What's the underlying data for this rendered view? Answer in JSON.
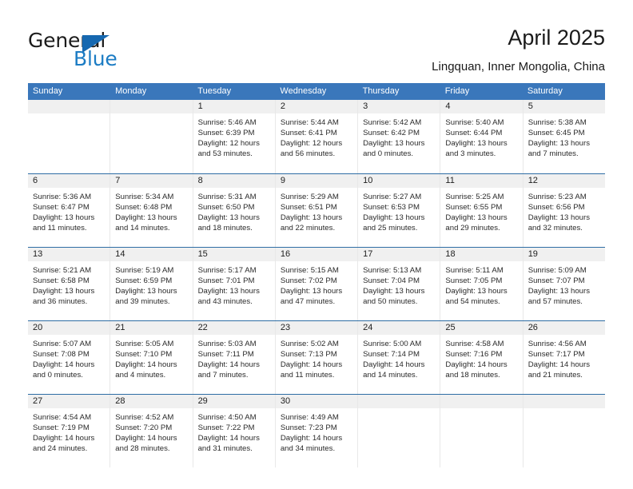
{
  "brand": {
    "name_part1": "General",
    "name_part2": "Blue",
    "logo_icon": "triangle-flag-icon"
  },
  "header": {
    "title": "April 2025",
    "location": "Lingquan, Inner Mongolia, China"
  },
  "calendar": {
    "day_headers": [
      "Sunday",
      "Monday",
      "Tuesday",
      "Wednesday",
      "Thursday",
      "Friday",
      "Saturday"
    ],
    "accent_color": "#3a77bb",
    "row_divider_color": "#2e6da4",
    "day_band_color": "#f0f0f0",
    "weeks": [
      [
        {
          "date": "",
          "empty": true
        },
        {
          "date": "",
          "empty": true
        },
        {
          "date": "1",
          "sunrise": "Sunrise: 5:46 AM",
          "sunset": "Sunset: 6:39 PM",
          "daylight_line1": "Daylight: 12 hours",
          "daylight_line2": "and 53 minutes."
        },
        {
          "date": "2",
          "sunrise": "Sunrise: 5:44 AM",
          "sunset": "Sunset: 6:41 PM",
          "daylight_line1": "Daylight: 12 hours",
          "daylight_line2": "and 56 minutes."
        },
        {
          "date": "3",
          "sunrise": "Sunrise: 5:42 AM",
          "sunset": "Sunset: 6:42 PM",
          "daylight_line1": "Daylight: 13 hours",
          "daylight_line2": "and 0 minutes."
        },
        {
          "date": "4",
          "sunrise": "Sunrise: 5:40 AM",
          "sunset": "Sunset: 6:44 PM",
          "daylight_line1": "Daylight: 13 hours",
          "daylight_line2": "and 3 minutes."
        },
        {
          "date": "5",
          "sunrise": "Sunrise: 5:38 AM",
          "sunset": "Sunset: 6:45 PM",
          "daylight_line1": "Daylight: 13 hours",
          "daylight_line2": "and 7 minutes."
        }
      ],
      [
        {
          "date": "6",
          "sunrise": "Sunrise: 5:36 AM",
          "sunset": "Sunset: 6:47 PM",
          "daylight_line1": "Daylight: 13 hours",
          "daylight_line2": "and 11 minutes."
        },
        {
          "date": "7",
          "sunrise": "Sunrise: 5:34 AM",
          "sunset": "Sunset: 6:48 PM",
          "daylight_line1": "Daylight: 13 hours",
          "daylight_line2": "and 14 minutes."
        },
        {
          "date": "8",
          "sunrise": "Sunrise: 5:31 AM",
          "sunset": "Sunset: 6:50 PM",
          "daylight_line1": "Daylight: 13 hours",
          "daylight_line2": "and 18 minutes."
        },
        {
          "date": "9",
          "sunrise": "Sunrise: 5:29 AM",
          "sunset": "Sunset: 6:51 PM",
          "daylight_line1": "Daylight: 13 hours",
          "daylight_line2": "and 22 minutes."
        },
        {
          "date": "10",
          "sunrise": "Sunrise: 5:27 AM",
          "sunset": "Sunset: 6:53 PM",
          "daylight_line1": "Daylight: 13 hours",
          "daylight_line2": "and 25 minutes."
        },
        {
          "date": "11",
          "sunrise": "Sunrise: 5:25 AM",
          "sunset": "Sunset: 6:55 PM",
          "daylight_line1": "Daylight: 13 hours",
          "daylight_line2": "and 29 minutes."
        },
        {
          "date": "12",
          "sunrise": "Sunrise: 5:23 AM",
          "sunset": "Sunset: 6:56 PM",
          "daylight_line1": "Daylight: 13 hours",
          "daylight_line2": "and 32 minutes."
        }
      ],
      [
        {
          "date": "13",
          "sunrise": "Sunrise: 5:21 AM",
          "sunset": "Sunset: 6:58 PM",
          "daylight_line1": "Daylight: 13 hours",
          "daylight_line2": "and 36 minutes."
        },
        {
          "date": "14",
          "sunrise": "Sunrise: 5:19 AM",
          "sunset": "Sunset: 6:59 PM",
          "daylight_line1": "Daylight: 13 hours",
          "daylight_line2": "and 39 minutes."
        },
        {
          "date": "15",
          "sunrise": "Sunrise: 5:17 AM",
          "sunset": "Sunset: 7:01 PM",
          "daylight_line1": "Daylight: 13 hours",
          "daylight_line2": "and 43 minutes."
        },
        {
          "date": "16",
          "sunrise": "Sunrise: 5:15 AM",
          "sunset": "Sunset: 7:02 PM",
          "daylight_line1": "Daylight: 13 hours",
          "daylight_line2": "and 47 minutes."
        },
        {
          "date": "17",
          "sunrise": "Sunrise: 5:13 AM",
          "sunset": "Sunset: 7:04 PM",
          "daylight_line1": "Daylight: 13 hours",
          "daylight_line2": "and 50 minutes."
        },
        {
          "date": "18",
          "sunrise": "Sunrise: 5:11 AM",
          "sunset": "Sunset: 7:05 PM",
          "daylight_line1": "Daylight: 13 hours",
          "daylight_line2": "and 54 minutes."
        },
        {
          "date": "19",
          "sunrise": "Sunrise: 5:09 AM",
          "sunset": "Sunset: 7:07 PM",
          "daylight_line1": "Daylight: 13 hours",
          "daylight_line2": "and 57 minutes."
        }
      ],
      [
        {
          "date": "20",
          "sunrise": "Sunrise: 5:07 AM",
          "sunset": "Sunset: 7:08 PM",
          "daylight_line1": "Daylight: 14 hours",
          "daylight_line2": "and 0 minutes."
        },
        {
          "date": "21",
          "sunrise": "Sunrise: 5:05 AM",
          "sunset": "Sunset: 7:10 PM",
          "daylight_line1": "Daylight: 14 hours",
          "daylight_line2": "and 4 minutes."
        },
        {
          "date": "22",
          "sunrise": "Sunrise: 5:03 AM",
          "sunset": "Sunset: 7:11 PM",
          "daylight_line1": "Daylight: 14 hours",
          "daylight_line2": "and 7 minutes."
        },
        {
          "date": "23",
          "sunrise": "Sunrise: 5:02 AM",
          "sunset": "Sunset: 7:13 PM",
          "daylight_line1": "Daylight: 14 hours",
          "daylight_line2": "and 11 minutes."
        },
        {
          "date": "24",
          "sunrise": "Sunrise: 5:00 AM",
          "sunset": "Sunset: 7:14 PM",
          "daylight_line1": "Daylight: 14 hours",
          "daylight_line2": "and 14 minutes."
        },
        {
          "date": "25",
          "sunrise": "Sunrise: 4:58 AM",
          "sunset": "Sunset: 7:16 PM",
          "daylight_line1": "Daylight: 14 hours",
          "daylight_line2": "and 18 minutes."
        },
        {
          "date": "26",
          "sunrise": "Sunrise: 4:56 AM",
          "sunset": "Sunset: 7:17 PM",
          "daylight_line1": "Daylight: 14 hours",
          "daylight_line2": "and 21 minutes."
        }
      ],
      [
        {
          "date": "27",
          "sunrise": "Sunrise: 4:54 AM",
          "sunset": "Sunset: 7:19 PM",
          "daylight_line1": "Daylight: 14 hours",
          "daylight_line2": "and 24 minutes."
        },
        {
          "date": "28",
          "sunrise": "Sunrise: 4:52 AM",
          "sunset": "Sunset: 7:20 PM",
          "daylight_line1": "Daylight: 14 hours",
          "daylight_line2": "and 28 minutes."
        },
        {
          "date": "29",
          "sunrise": "Sunrise: 4:50 AM",
          "sunset": "Sunset: 7:22 PM",
          "daylight_line1": "Daylight: 14 hours",
          "daylight_line2": "and 31 minutes."
        },
        {
          "date": "30",
          "sunrise": "Sunrise: 4:49 AM",
          "sunset": "Sunset: 7:23 PM",
          "daylight_line1": "Daylight: 14 hours",
          "daylight_line2": "and 34 minutes."
        },
        {
          "date": "",
          "empty": true
        },
        {
          "date": "",
          "empty": true
        },
        {
          "date": "",
          "empty": true
        }
      ]
    ]
  }
}
